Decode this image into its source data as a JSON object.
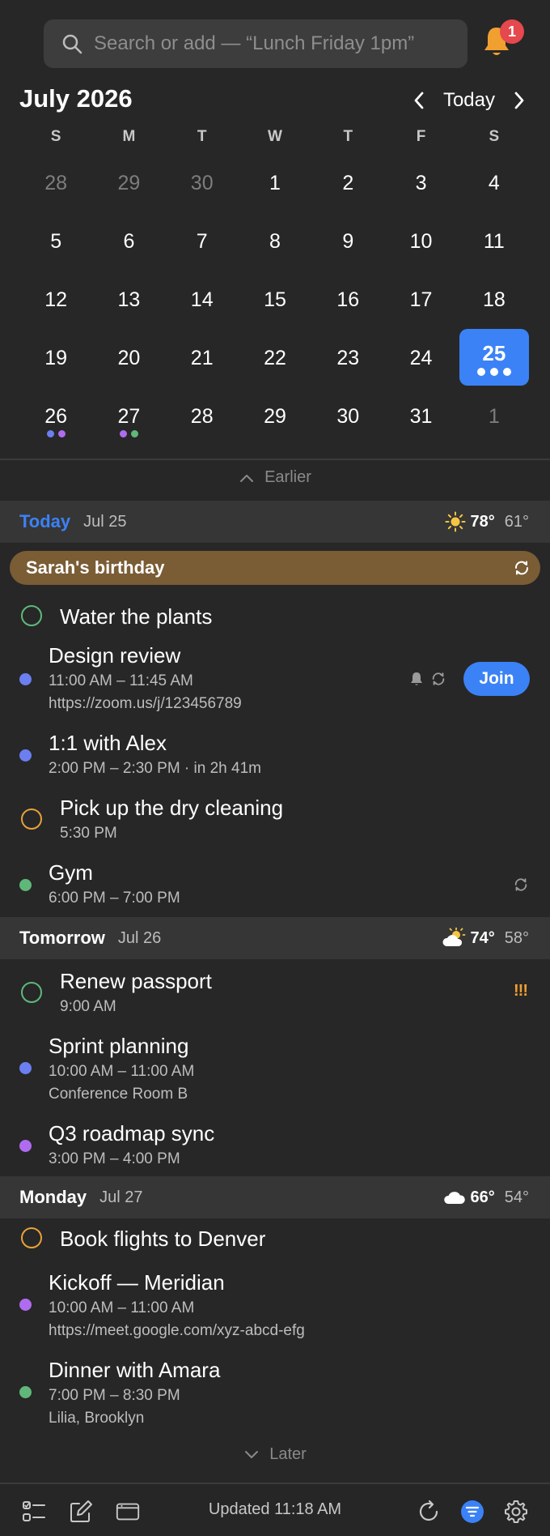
{
  "search": {
    "placeholder": "Search or add — “Lunch Friday 1pm”"
  },
  "notifications": {
    "count": "1"
  },
  "calendar": {
    "month_title": "July 2026",
    "today_label": "Today",
    "weekdays": [
      "S",
      "M",
      "T",
      "W",
      "T",
      "F",
      "S"
    ],
    "weeks": [
      [
        {
          "n": "28",
          "muted": true
        },
        {
          "n": "29",
          "muted": true
        },
        {
          "n": "30",
          "muted": true
        },
        {
          "n": "1"
        },
        {
          "n": "2"
        },
        {
          "n": "3"
        },
        {
          "n": "4"
        }
      ],
      [
        {
          "n": "5"
        },
        {
          "n": "6"
        },
        {
          "n": "7"
        },
        {
          "n": "8"
        },
        {
          "n": "9"
        },
        {
          "n": "10"
        },
        {
          "n": "11"
        }
      ],
      [
        {
          "n": "12"
        },
        {
          "n": "13"
        },
        {
          "n": "14"
        },
        {
          "n": "15"
        },
        {
          "n": "16"
        },
        {
          "n": "17"
        },
        {
          "n": "18"
        }
      ],
      [
        {
          "n": "19"
        },
        {
          "n": "20"
        },
        {
          "n": "21"
        },
        {
          "n": "22"
        },
        {
          "n": "23"
        },
        {
          "n": "24"
        },
        {
          "n": "25",
          "selected": true,
          "dots": [
            "#ffffff",
            "#ffffff",
            "#ffffff"
          ]
        }
      ],
      [
        {
          "n": "26",
          "dots": [
            "#6b7ff0",
            "#b06cf0"
          ]
        },
        {
          "n": "27",
          "dots": [
            "#b06cf0",
            "#5fb87a"
          ]
        },
        {
          "n": "28"
        },
        {
          "n": "29"
        },
        {
          "n": "30"
        },
        {
          "n": "31"
        },
        {
          "n": "1",
          "muted": true
        }
      ]
    ]
  },
  "earlier_label": "Earlier",
  "later_label": "Later",
  "sections": {
    "today": {
      "label": "Today",
      "date": "Jul 25",
      "hi": "78°",
      "lo": "61°",
      "weather_icon": "sun-icon"
    },
    "tomorrow": {
      "label": "Tomorrow",
      "date": "Jul 26",
      "hi": "74°",
      "lo": "58°",
      "weather_icon": "partly-sunny-icon"
    },
    "monday": {
      "label": "Monday",
      "date": "Jul 27",
      "hi": "66°",
      "lo": "54°",
      "weather_icon": "cloud-icon"
    }
  },
  "birthday": {
    "title": "Sarah's birthday"
  },
  "items": {
    "water": {
      "title": "Water the plants"
    },
    "design": {
      "title": "Design review",
      "time": "11:00 AM – 11:45 AM",
      "link": "https://zoom.us/j/123456789",
      "join": "Join"
    },
    "alex": {
      "title": "1:1 with Alex",
      "time": "2:00 PM – 2:30 PM · in 2h 41m"
    },
    "cleaning": {
      "title": "Pick up the dry cleaning",
      "time": "5:30 PM"
    },
    "gym": {
      "title": "Gym",
      "time": "6:00 PM – 7:00 PM"
    },
    "passport": {
      "title": "Renew passport",
      "time": "9:00 AM",
      "priority": "!!!"
    },
    "sprint": {
      "title": "Sprint planning",
      "time": "10:00 AM – 11:00 AM",
      "location": "Conference Room B"
    },
    "roadmap": {
      "title": "Q3 roadmap sync",
      "time": "3:00 PM – 4:00 PM"
    },
    "flights": {
      "title": "Book flights to Denver"
    },
    "kickoff": {
      "title": "Kickoff — Meridian",
      "time": "10:00 AM – 11:00 AM",
      "link": "https://meet.google.com/xyz-abcd-efg"
    },
    "dinner": {
      "title": "Dinner with Amara",
      "time": "7:00 PM – 8:30 PM",
      "location": "Lilia, Brooklyn"
    }
  },
  "toolbar": {
    "updated": "Updated 11:18 AM"
  },
  "colors": {
    "accent": "#3b82f6",
    "blue_event": "#6b7ff0",
    "purple_event": "#b06cf0",
    "green_event": "#5fb87a",
    "orange_task": "#e8a13a",
    "birthday_bg": "#7a5c35"
  }
}
